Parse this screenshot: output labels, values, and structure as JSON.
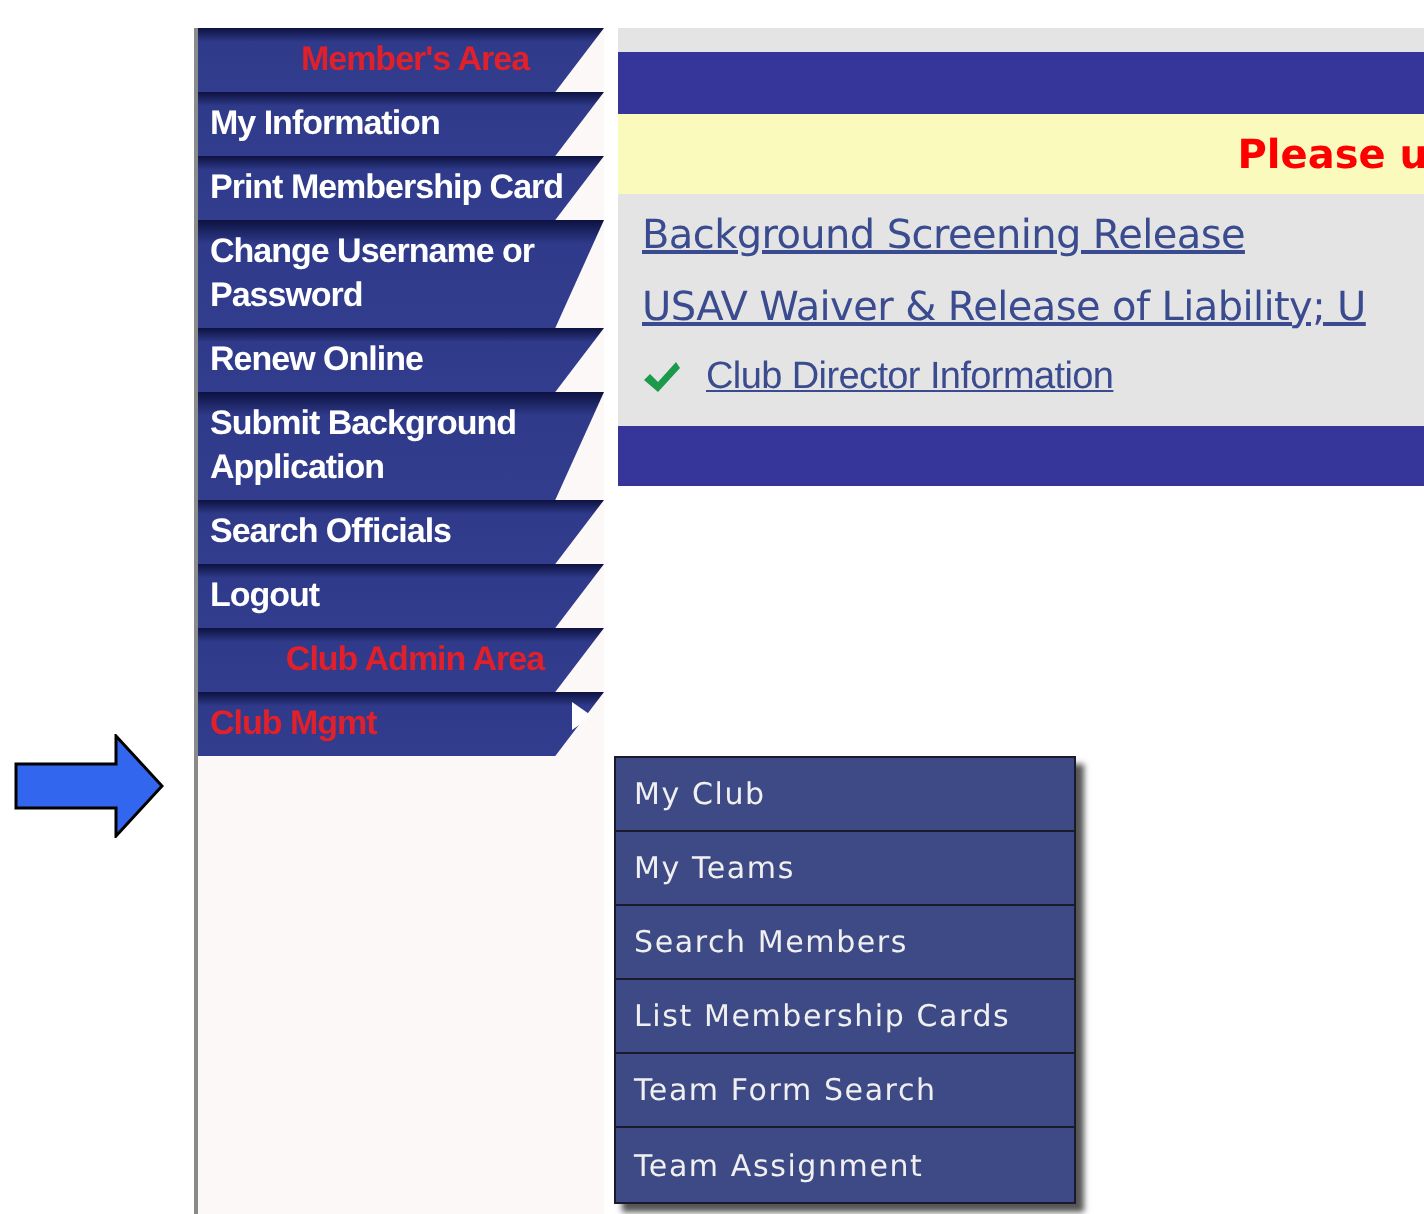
{
  "sidebar": {
    "items": [
      {
        "kind": "header",
        "label": "Member's Area"
      },
      {
        "kind": "link",
        "label": "My Information"
      },
      {
        "kind": "link",
        "label": "Print Membership Card"
      },
      {
        "kind": "link",
        "label": "Change Username or Password"
      },
      {
        "kind": "link",
        "label": "Renew Online"
      },
      {
        "kind": "link",
        "label": "Submit Background Application"
      },
      {
        "kind": "link",
        "label": "Search Officials"
      },
      {
        "kind": "link",
        "label": "Logout"
      },
      {
        "kind": "header",
        "label": "Club Admin Area"
      },
      {
        "kind": "submenu",
        "label": "Club Mgmt",
        "expanded": true
      }
    ]
  },
  "notice": {
    "text": "Please u"
  },
  "links": [
    {
      "label": "Background Screening Release",
      "checked": false
    },
    {
      "label": "USAV Waiver & Release of Liability; U",
      "checked": false
    },
    {
      "label": "Club Director Information",
      "checked": true
    }
  ],
  "submenu": {
    "items": [
      "My Club",
      "My Teams",
      "Search Members",
      "List Membership Cards",
      "Team Form Search",
      "Team Assignment"
    ]
  }
}
